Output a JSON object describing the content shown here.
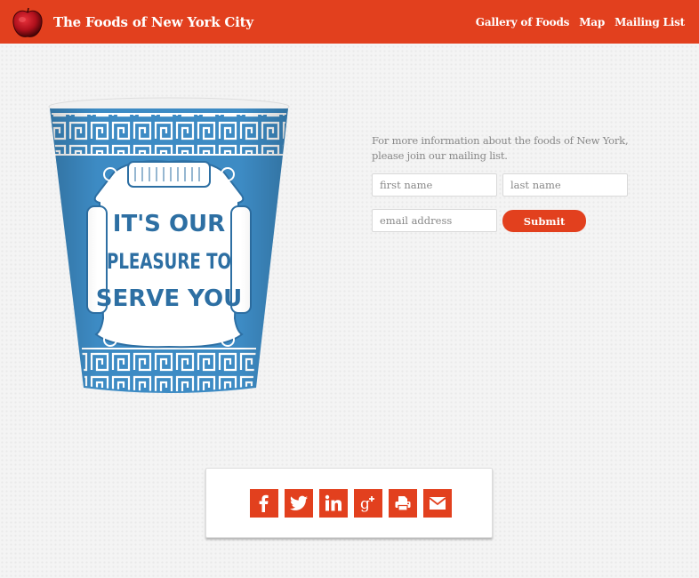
{
  "header": {
    "title": "The Foods of New York City",
    "logo_icon": "apple-icon",
    "nav": [
      {
        "label": "Gallery of Foods"
      },
      {
        "label": "Map"
      },
      {
        "label": "Mailing List"
      }
    ]
  },
  "hero_image": {
    "alt": "Greek coffee cup",
    "cup_text": [
      "IT'S OUR",
      "PLEASURE TO",
      "SERVE YOU"
    ]
  },
  "signup": {
    "intro_line1": "For more information about the foods of New York,",
    "intro_line2": "please join our mailing list.",
    "first_name_placeholder": "first name",
    "last_name_placeholder": "last name",
    "email_placeholder": "email address",
    "first_name_value": "",
    "last_name_value": "",
    "email_value": "",
    "submit_label": "Submit"
  },
  "share": {
    "buttons": [
      {
        "icon": "facebook-icon"
      },
      {
        "icon": "twitter-icon"
      },
      {
        "icon": "linkedin-icon"
      },
      {
        "icon": "google-plus-icon"
      },
      {
        "icon": "print-icon"
      },
      {
        "icon": "email-icon"
      }
    ]
  },
  "colors": {
    "accent": "#e2401e",
    "cup_blue": "#3d8bc4",
    "text_muted": "#888888"
  }
}
